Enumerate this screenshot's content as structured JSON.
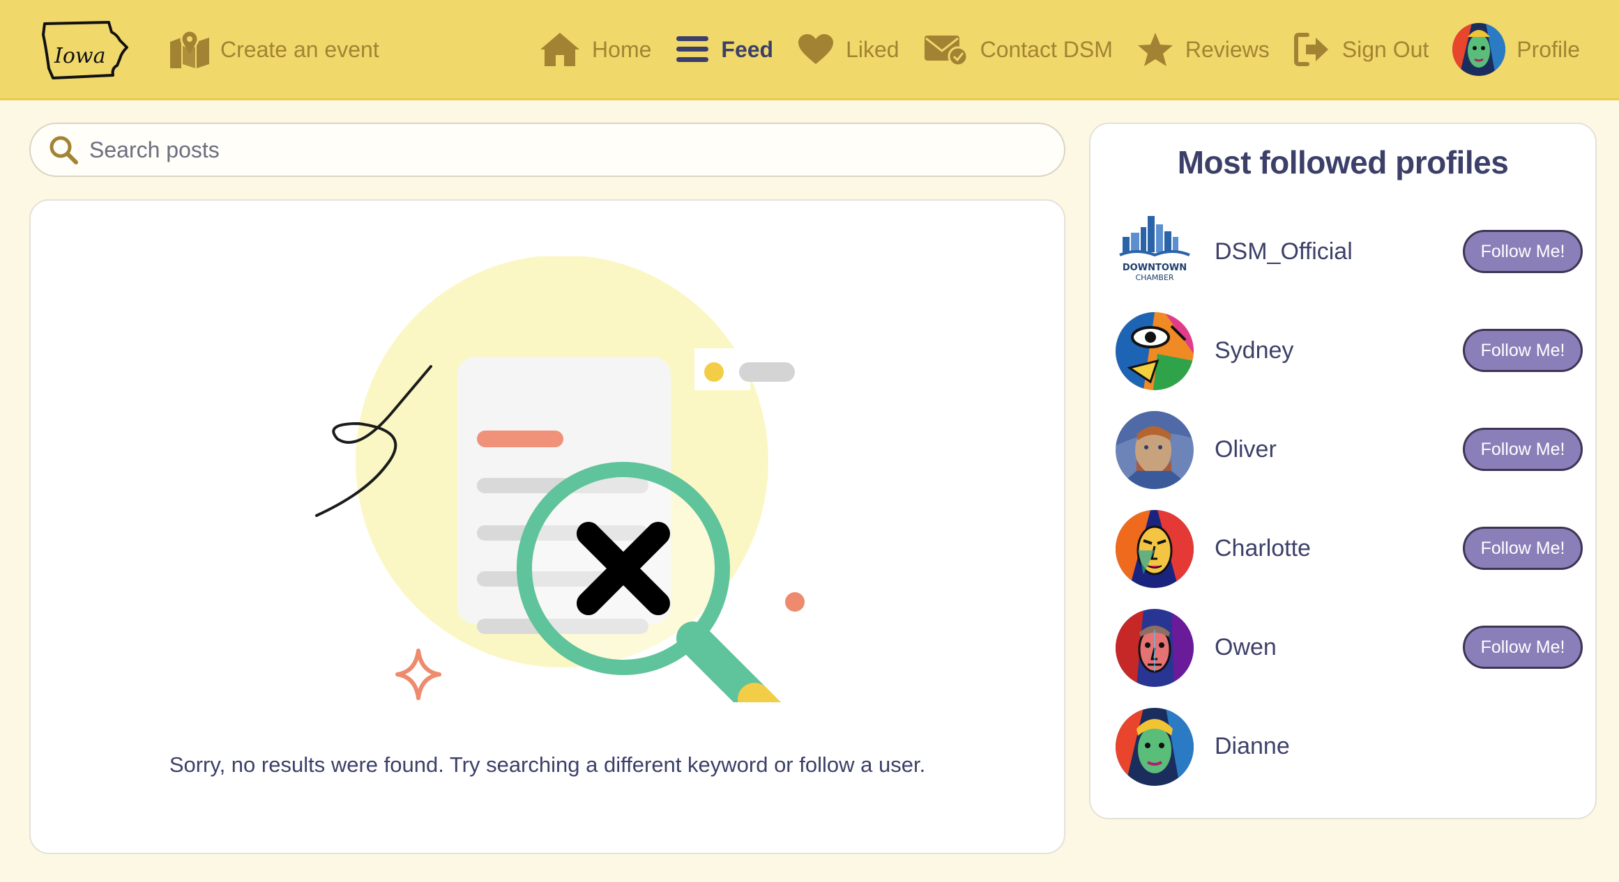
{
  "header": {
    "logo_text": "Iowa",
    "create_event_label": "Create an event",
    "nav": {
      "home": "Home",
      "feed": "Feed",
      "liked": "Liked",
      "contact": "Contact DSM",
      "reviews": "Reviews",
      "sign_out": "Sign Out",
      "profile": "Profile"
    },
    "active_item": "feed"
  },
  "search": {
    "placeholder": "Search posts",
    "value": ""
  },
  "feed": {
    "empty_message": "Sorry, no results were found. Try searching a different keyword or follow a user."
  },
  "sidebar": {
    "title": "Most followed profiles",
    "follow_label": "Follow Me!",
    "profiles": [
      {
        "name": "DSM_Official",
        "avatar_logo_line1": "DOWNTOWN",
        "avatar_logo_line2": "CHAMBER"
      },
      {
        "name": "Sydney"
      },
      {
        "name": "Oliver"
      },
      {
        "name": "Charlotte"
      },
      {
        "name": "Owen"
      },
      {
        "name": "Dianne"
      }
    ]
  },
  "colors": {
    "header_bg": "#f1d86b",
    "page_bg": "#fdf8e4",
    "nav_text": "#a28333",
    "primary_text": "#3c4068",
    "follow_button": "#8a7fb8",
    "magnifier": "#5fc39b"
  }
}
